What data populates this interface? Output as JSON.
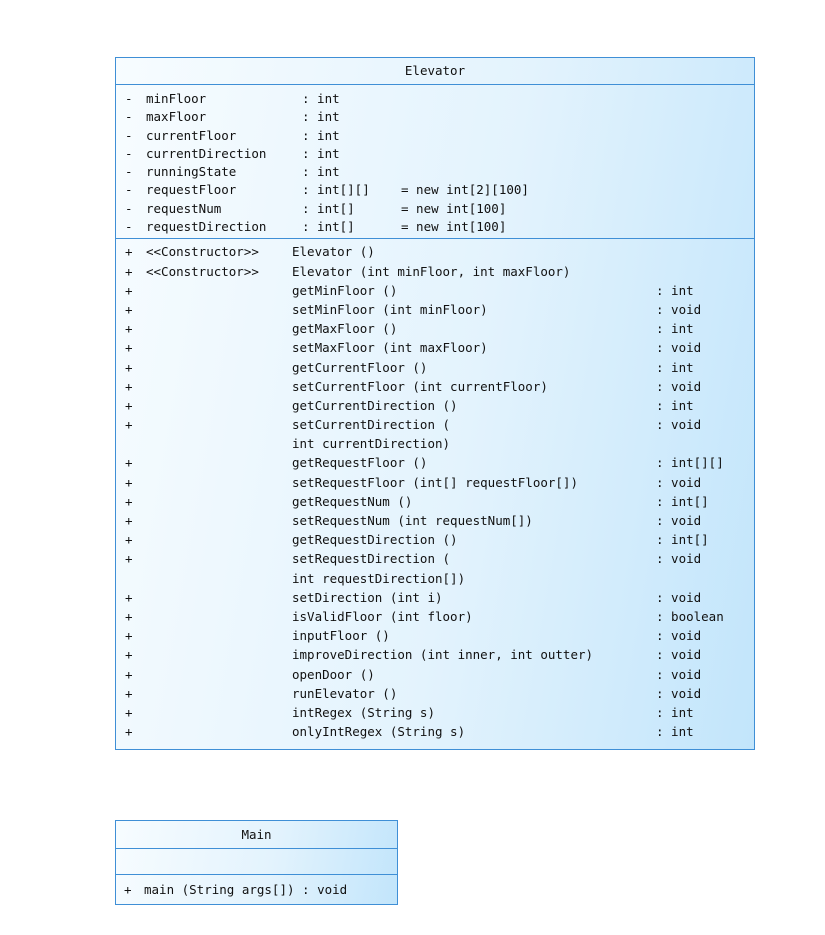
{
  "elevator": {
    "name": "Elevator",
    "attributes": [
      {
        "vis": "-",
        "name": "minFloor",
        "type": ": int",
        "init": ""
      },
      {
        "vis": "-",
        "name": "maxFloor",
        "type": ": int",
        "init": ""
      },
      {
        "vis": "-",
        "name": "currentFloor",
        "type": ": int",
        "init": ""
      },
      {
        "vis": "-",
        "name": "currentDirection",
        "type": ": int",
        "init": ""
      },
      {
        "vis": "-",
        "name": "runningState",
        "type": ": int",
        "init": ""
      },
      {
        "vis": "-",
        "name": "requestFloor",
        "type": ": int[][]",
        "init": "= new int[2][100]"
      },
      {
        "vis": "-",
        "name": "requestNum",
        "type": ": int[]",
        "init": "= new int[100]"
      },
      {
        "vis": "-",
        "name": "requestDirection",
        "type": ": int[]",
        "init": "= new int[100]"
      }
    ],
    "operations": [
      {
        "vis": "+",
        "stereo": "<<Constructor>>",
        "name": "Elevator ()",
        "cont": "",
        "type": ""
      },
      {
        "vis": "+",
        "stereo": "<<Constructor>>",
        "name": "Elevator (int minFloor, int maxFloor)",
        "cont": "",
        "type": ""
      },
      {
        "vis": "+",
        "stereo": "",
        "name": "getMinFloor ()",
        "cont": "",
        "type": ": int"
      },
      {
        "vis": "+",
        "stereo": "",
        "name": "setMinFloor (int minFloor)",
        "cont": "",
        "type": ": void"
      },
      {
        "vis": "+",
        "stereo": "",
        "name": "getMaxFloor ()",
        "cont": "",
        "type": ": int"
      },
      {
        "vis": "+",
        "stereo": "",
        "name": "setMaxFloor (int maxFloor)",
        "cont": "",
        "type": ": void"
      },
      {
        "vis": "+",
        "stereo": "",
        "name": "getCurrentFloor ()",
        "cont": "",
        "type": ": int"
      },
      {
        "vis": "+",
        "stereo": "",
        "name": "setCurrentFloor (int currentFloor)",
        "cont": "",
        "type": ": void"
      },
      {
        "vis": "+",
        "stereo": "",
        "name": "getCurrentDirection ()",
        "cont": "",
        "type": ": int"
      },
      {
        "vis": "+",
        "stereo": "",
        "name": "setCurrentDirection (",
        "cont": "int currentDirection)",
        "type": ": void"
      },
      {
        "vis": "+",
        "stereo": "",
        "name": "getRequestFloor ()",
        "cont": "",
        "type": ": int[][]"
      },
      {
        "vis": "+",
        "stereo": "",
        "name": "setRequestFloor (int[] requestFloor[])",
        "cont": "",
        "type": ": void"
      },
      {
        "vis": "+",
        "stereo": "",
        "name": "getRequestNum ()",
        "cont": "",
        "type": ": int[]"
      },
      {
        "vis": "+",
        "stereo": "",
        "name": "setRequestNum (int requestNum[])",
        "cont": "",
        "type": ": void"
      },
      {
        "vis": "+",
        "stereo": "",
        "name": "getRequestDirection ()",
        "cont": "",
        "type": ": int[]"
      },
      {
        "vis": "+",
        "stereo": "",
        "name": "setRequestDirection (",
        "cont": "int requestDirection[])",
        "type": ": void"
      },
      {
        "vis": "+",
        "stereo": "",
        "name": "setDirection (int i)",
        "cont": "",
        "type": ": void"
      },
      {
        "vis": "+",
        "stereo": "",
        "name": "isValidFloor (int floor)",
        "cont": "",
        "type": ": boolean"
      },
      {
        "vis": "+",
        "stereo": "",
        "name": "inputFloor ()",
        "cont": "",
        "type": ": void"
      },
      {
        "vis": "+",
        "stereo": "",
        "name": "improveDirection (int inner, int outter)",
        "cont": "",
        "type": ": void"
      },
      {
        "vis": "+",
        "stereo": "",
        "name": "openDoor ()",
        "cont": "",
        "type": ": void"
      },
      {
        "vis": "+",
        "stereo": "",
        "name": "runElevator ()",
        "cont": "",
        "type": ": void"
      },
      {
        "vis": "+",
        "stereo": "",
        "name": "intRegex (String s)",
        "cont": "",
        "type": ": int"
      },
      {
        "vis": "+",
        "stereo": "",
        "name": "onlyIntRegex (String s)",
        "cont": "",
        "type": ": int"
      }
    ]
  },
  "main": {
    "name": "Main",
    "operations": [
      {
        "vis": "+",
        "text": "main (String args[])  : void"
      }
    ]
  }
}
